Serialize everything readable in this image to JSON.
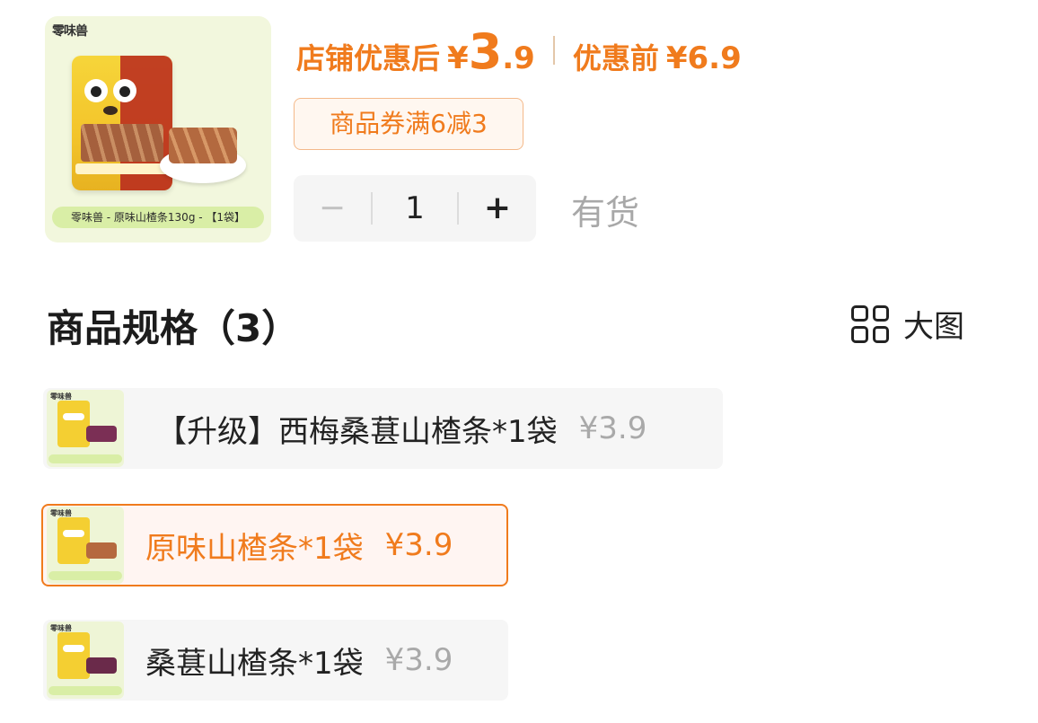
{
  "product": {
    "brand": "零味兽",
    "caption": "零味兽 - 原味山楂条130g - 【1袋】"
  },
  "price": {
    "after_label": "店铺优惠后",
    "currency": "¥",
    "after_int": "3",
    "after_dec": ".9",
    "before_label": "优惠前",
    "before_value": "¥6.9"
  },
  "coupon": {
    "text": "商品券满6减3"
  },
  "quantity": {
    "minus": "−",
    "value": "1",
    "plus": "+"
  },
  "stock": "有货",
  "specs_section": {
    "title": "商品规格（3）",
    "view_toggle_label": "大图",
    "options": [
      {
        "name": "【升级】西梅桑葚山楂条*1袋",
        "price": "¥3.9",
        "selected": false
      },
      {
        "name": "原味山楂条*1袋",
        "price": "¥3.9",
        "selected": true
      },
      {
        "name": "桑葚山楂条*1袋",
        "price": "¥3.9",
        "selected": false
      }
    ]
  },
  "colors": {
    "accent": "#f07b1d",
    "muted": "#a9a9a9"
  }
}
